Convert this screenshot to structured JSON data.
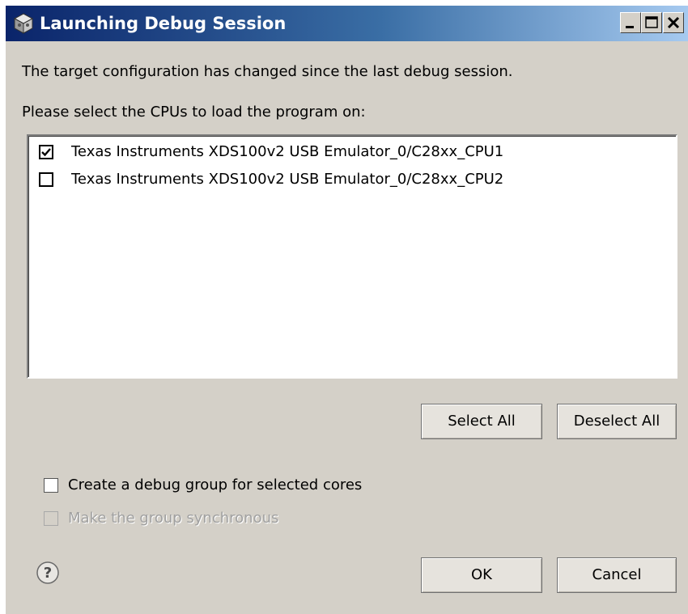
{
  "window": {
    "title": "Launching Debug Session",
    "title_icon": "debug-cube-icon",
    "controls": [
      "minimize-icon",
      "maximize-icon",
      "close-icon"
    ]
  },
  "main": {
    "message": "The target configuration has changed since the last debug session.",
    "prompt": "Please select the CPUs to load the program on:"
  },
  "cpu_list": {
    "items": [
      {
        "label": "Texas Instruments XDS100v2 USB Emulator_0/C28xx_CPU1",
        "checked": true
      },
      {
        "label": "Texas Instruments XDS100v2 USB Emulator_0/C28xx_CPU2",
        "checked": false
      }
    ]
  },
  "buttons": {
    "select_all": "Select All",
    "deselect_all": "Deselect All",
    "ok": "OK",
    "cancel": "Cancel"
  },
  "options": {
    "debug_group": {
      "label": "Create a debug group for selected cores",
      "checked": false,
      "enabled": true
    },
    "synchronous": {
      "label": "Make the group synchronous",
      "checked": false,
      "enabled": false
    }
  },
  "help": {
    "icon": "help-icon"
  },
  "colors": {
    "title_gradient_start": "#0a246a",
    "title_gradient_end": "#a6caf0",
    "dialog_background": "#d4d0c8"
  }
}
